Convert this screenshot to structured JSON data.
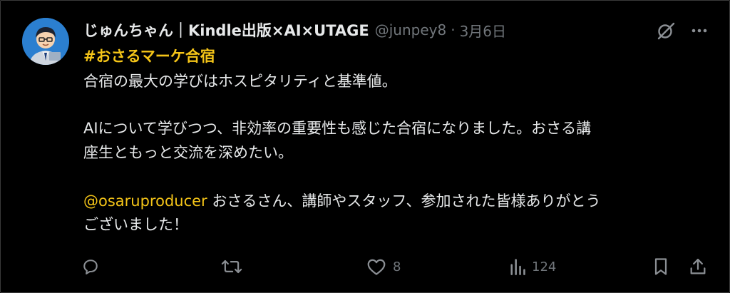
{
  "post": {
    "author": {
      "display_name": "じゅんちゃん｜Kindle出版×AI×UTAGE",
      "handle": "@junpey8",
      "separator": "·",
      "date": "3月6日"
    },
    "hashtag": "#おさるマーケ合宿",
    "lines": {
      "l1": "合宿の最大の学びはホスピタリティと基準値。",
      "l2": "AIについて学びつつ、非効率の重要性も感じた合宿になりました。おさる講",
      "l3": "座生ともっと交流を深めたい。",
      "l4_mention": "@osaruproducer",
      "l4_rest": " おさるさん、講師やスタッフ、参加された皆様ありがとう",
      "l5": "ございました！"
    },
    "actions": {
      "reply_icon": "reply-icon",
      "repost_icon": "repost-icon",
      "like_icon": "heart-icon",
      "like_count": "8",
      "views_icon": "views-chart-icon",
      "views_count": "124",
      "bookmark_icon": "bookmark-icon",
      "share_icon": "share-icon"
    },
    "colors": {
      "background": "#000000",
      "text": "#e7e9ea",
      "muted": "#71767b",
      "accent": "#f5c518"
    }
  }
}
